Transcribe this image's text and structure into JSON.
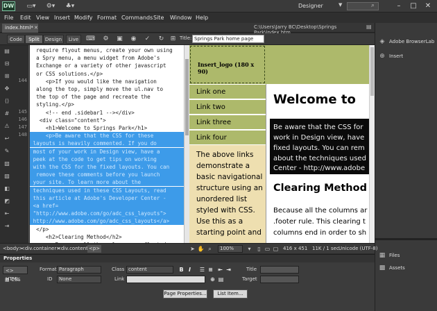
{
  "app": {
    "logo": "DW",
    "workspace": "Designer",
    "window_controls": [
      "–",
      "□",
      "✕"
    ]
  },
  "menu": [
    "File",
    "Edit",
    "View",
    "Insert",
    "Modify",
    "Format",
    "Commands",
    "Site",
    "Window",
    "Help"
  ],
  "document": {
    "tab_label": "index.html*",
    "path": "C:\\Users\\Jarry BC\\Desktop\\Springs Park\\index.htm",
    "views": [
      "Code",
      "Split",
      "Design",
      "Live"
    ],
    "active_view": "Split",
    "title_label": "Title:",
    "title_value": "Springs Park home page"
  },
  "right_panel": {
    "top_items": [
      "Adobe BrowserLab",
      "Insert"
    ],
    "bottom_items": [
      "Files",
      "Assets"
    ]
  },
  "code_lines": [
    {
      "no": "",
      "text": "  require flyout menus, create your own using",
      "sel": false
    },
    {
      "no": "",
      "text": "  a Spry menu, a menu widget from Adobe's",
      "sel": false
    },
    {
      "no": "",
      "text": "  Exchange or a variety of other javascript",
      "sel": false
    },
    {
      "no": "",
      "text": "  or CSS solutions.</p>",
      "sel": false
    },
    {
      "no": "144",
      "text": "     <p>If you would like the navigation",
      "sel": false
    },
    {
      "no": "",
      "text": "  along the top, simply move the ul.nav to",
      "sel": false
    },
    {
      "no": "",
      "text": "  the top of the page and recreate the",
      "sel": false
    },
    {
      "no": "",
      "text": "  styling.</p>",
      "sel": false
    },
    {
      "no": "145",
      "text": "     <!-- end .sidebar1 --></div>",
      "sel": false
    },
    {
      "no": "146",
      "text": "   <div class=\"content\">",
      "sel": false
    },
    {
      "no": "147",
      "text": "     <h1>Welcome to Springs Park</h1>",
      "sel": false
    },
    {
      "no": "148",
      "text": "     <p>Be aware that the CSS for these",
      "sel": true
    },
    {
      "no": "",
      "text": " layouts is heavily commented. If you do",
      "sel": true
    },
    {
      "no": "",
      "text": " most of your work in Design view, have a",
      "sel": true
    },
    {
      "no": "",
      "text": " peek at the code to get tips on working",
      "sel": true
    },
    {
      "no": "",
      "text": " with the CSS for the fixed layouts. You can",
      "sel": true
    },
    {
      "no": "",
      "text": "  remove these comments before you launch",
      "sel": true
    },
    {
      "no": "",
      "text": " your site. To learn more about the",
      "sel": true
    },
    {
      "no": "",
      "text": " techniques used in these CSS Layouts, read",
      "sel": true
    },
    {
      "no": "",
      "text": " this article at Adobe's Developer Center -",
      "sel": true
    },
    {
      "no": "",
      "text": " <a href=",
      "sel": true
    },
    {
      "no": "",
      "text": " \"http://www.adobe.com/go/adc_css_layouts\">",
      "sel": true
    },
    {
      "no": "",
      "text": " http://www.adobe.com/go/adc_css_layouts</a>",
      "sel": true
    },
    {
      "no": "",
      "text": "  </p>",
      "sel": false
    },
    {
      "no": "",
      "text": "     <h2>Clearing Method</h2>",
      "sel": false
    },
    {
      "no": "",
      "text": "     <p>Because all the columns are floated,",
      "sel": false
    }
  ],
  "design": {
    "logo_placeholder": "Insert_logo (180 x 90)",
    "nav_links": [
      "Link one",
      "Link two",
      "Link three",
      "Link four"
    ],
    "sidebar_text": "The above links\ndemonstrate a\nbasic navigational\nstructure using an\nunordered list\nstyled with CSS.\nUse this as a\nstarting point and",
    "heading": "Welcome to",
    "selected_lines": [
      "Be aware that the CSS for",
      "work in Design view, have",
      "fixed layouts. You can rem",
      "about the techniques used",
      "Center - http://www.adobe"
    ],
    "heading2": "Clearing Method",
    "body_lines": [
      "Because all the columns ar",
      ".footer rule. This clearing t",
      "columns end in order to sh"
    ]
  },
  "status_bar": {
    "breadcrumbs": [
      "<body>",
      "<div.container>",
      "<div.content>",
      "<p>"
    ],
    "zoom": "100%",
    "dimensions": "416 x 451",
    "file_info": "11K / 1 sec",
    "encoding": "Unicode (UTF-8)"
  },
  "properties": {
    "title": "Properties",
    "modes": [
      "HTML",
      "CSS"
    ],
    "format_label": "Format",
    "format_value": "Paragraph",
    "class_label": "Class",
    "class_value": "content",
    "id_label": "ID",
    "id_value": "None",
    "link_label": "Link",
    "title_label": "Title",
    "target_label": "Target",
    "bold": "B",
    "italic": "I",
    "page_properties": "Page Properties...",
    "list_item": "List Item..."
  },
  "colors": {
    "selection_code": "#3d9be9",
    "header_green": "#adb96b",
    "sidebar_tan": "#eedfb0"
  }
}
